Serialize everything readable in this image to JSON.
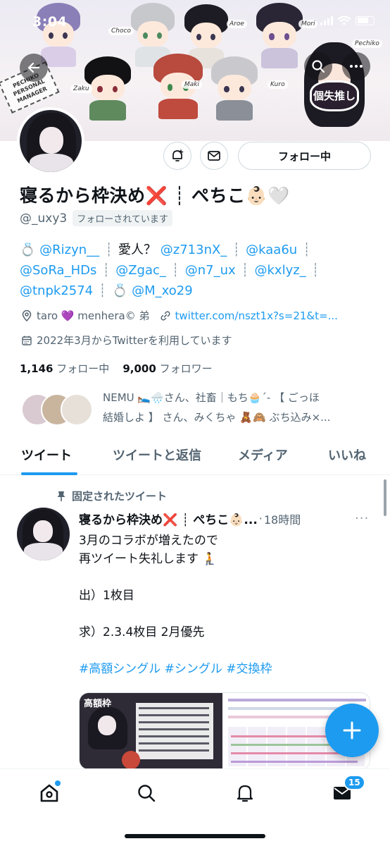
{
  "status_bar": {
    "time": "3:04"
  },
  "banner": {
    "character_tags": [
      "Choco",
      "Aroe",
      "Mori",
      "Pechiko",
      "Zaku",
      "Maki",
      "Kuro"
    ],
    "sticker_text": "PECHIKO PERSONAL MANAGER",
    "oshi_mask_text": "個失推し"
  },
  "profile": {
    "display_name": "寝るから枠決め❌ ┊ ぺちこ👶🏻🤍",
    "handle": "@_uxy3",
    "follows_you": "フォローされています",
    "follow_button": "フォロー中",
    "bio": {
      "line1": {
        "emoji": "💍",
        "m1": "@Rizyn__",
        "text": "愛人？",
        "m2": "@z713nX_",
        "m3": "@kaa6u"
      },
      "line2": {
        "m1": "@SoRa_HDs",
        "m2": "@Zgac_",
        "m3": "@n7_ux",
        "m4": "@kxlyz_"
      },
      "line3": {
        "m1": "@tnpk2574",
        "emoji": "💍",
        "m2": "@M_xo29"
      }
    },
    "location": "taro 💜 menhera© 弟",
    "url": "twitter.com/nszt1x?s=21&t=...",
    "joined": "2022年3月からTwitterを利用しています",
    "following_count": "1,146",
    "following_label": "フォロー中",
    "followers_count": "9,000",
    "followers_label": "フォロワー",
    "followed_by_line1": "NEMU 🛌🌧️さん、社畜｜もち🧁´- 【 ごっほ",
    "followed_by_line2": "結婚しよ 】 さん、みくちゃ 🧸🙈 ぶち込み×..."
  },
  "tabs": [
    "ツイート",
    "ツイートと返信",
    "メディア",
    "いいね"
  ],
  "active_tab": 0,
  "tweet": {
    "pinned_label": "固定されたツイート",
    "name": "寝るから枠決め❌ ┊ ぺちこ👶🏻...",
    "time": "18時間",
    "lines": [
      "3月のコラボが増えたので",
      "再ツイート失礼します 🧎",
      "",
      "出）1枚目",
      "",
      "求）2.3.4枚目 2月優先",
      ""
    ],
    "hashtags": "#高額シングル #シングル #交換枠",
    "media_label": "高額枠"
  },
  "bottom_nav": {
    "messages_badge": "15"
  },
  "colors": {
    "accent": "#1d9bf0",
    "text": "#0f1419",
    "secondary": "#536471"
  }
}
